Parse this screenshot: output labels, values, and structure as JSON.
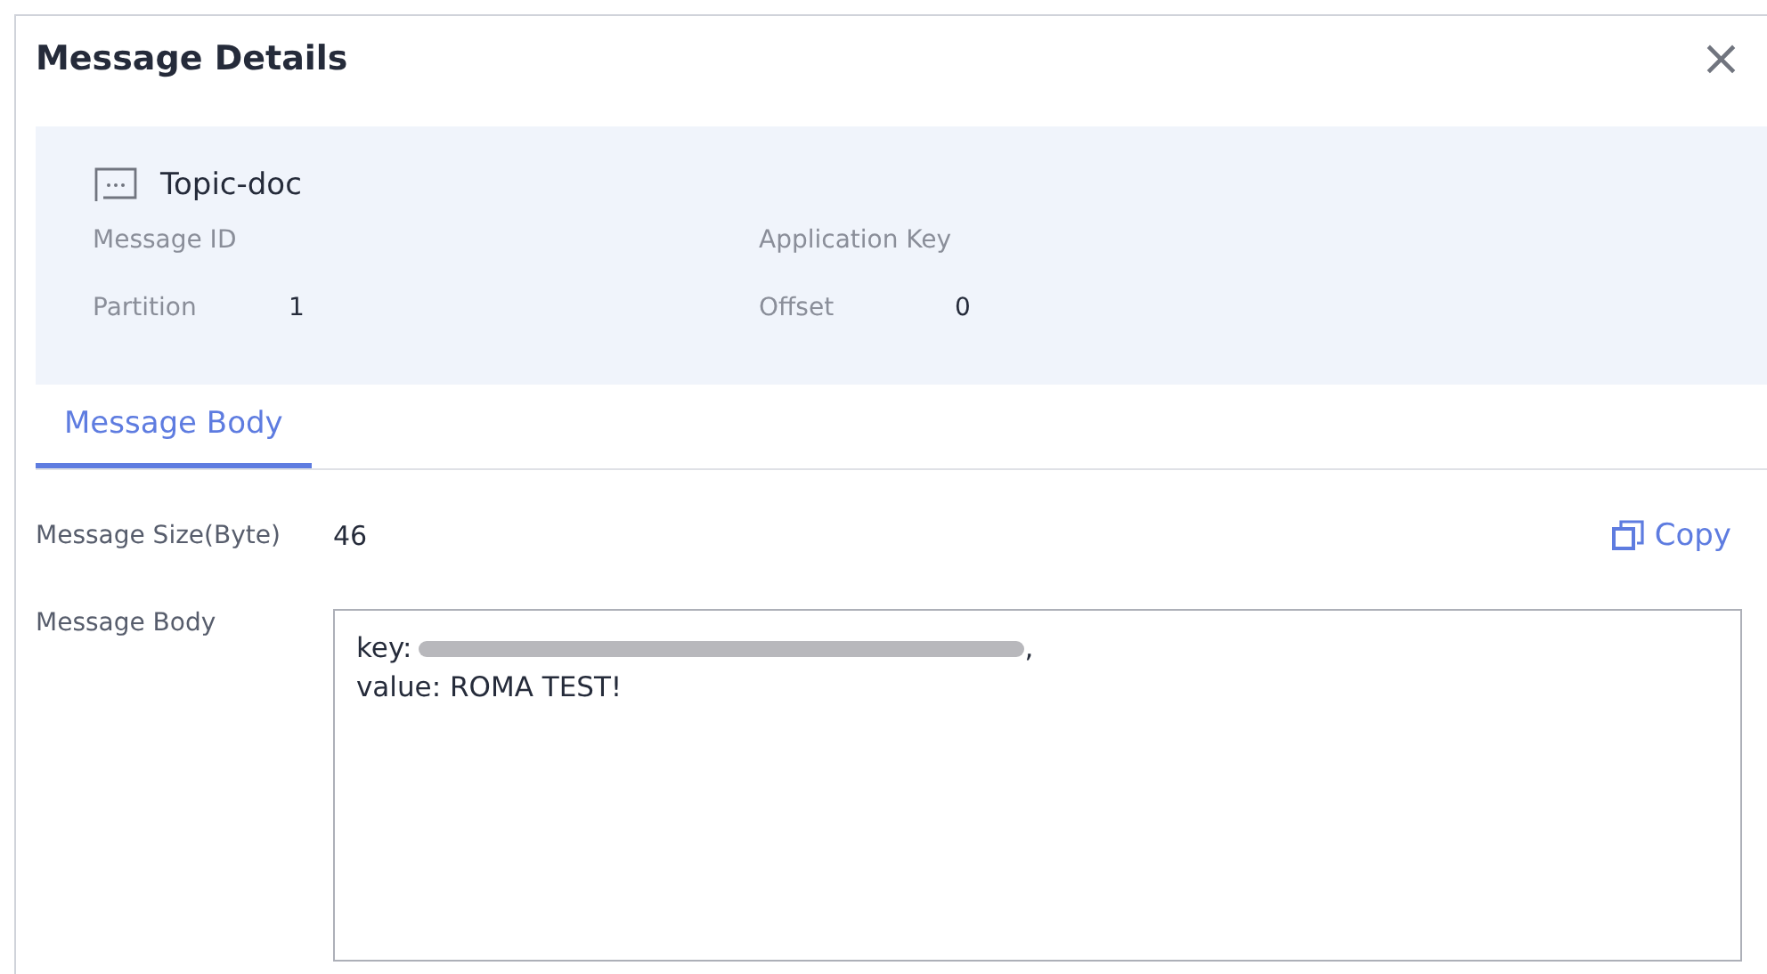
{
  "dialog": {
    "title": "Message Details",
    "close": "×"
  },
  "info": {
    "topic": "Topic-doc",
    "fields": [
      {
        "label": "Message ID"
      },
      {
        "label": "Application Key"
      },
      {
        "label": "Partition",
        "value": "1"
      },
      {
        "label": "Offset",
        "value": "0"
      }
    ]
  },
  "tabs": [
    {
      "label": "Message Body",
      "selected": true
    }
  ],
  "size": {
    "label": "Message Size(Byte)",
    "value": "46",
    "copy": "Copy"
  },
  "body": {
    "label": "Message Body",
    "key_label": "key:",
    "key_redacted": true,
    "key_suffix": ",",
    "value_line": "value: ROMA TEST!"
  }
}
